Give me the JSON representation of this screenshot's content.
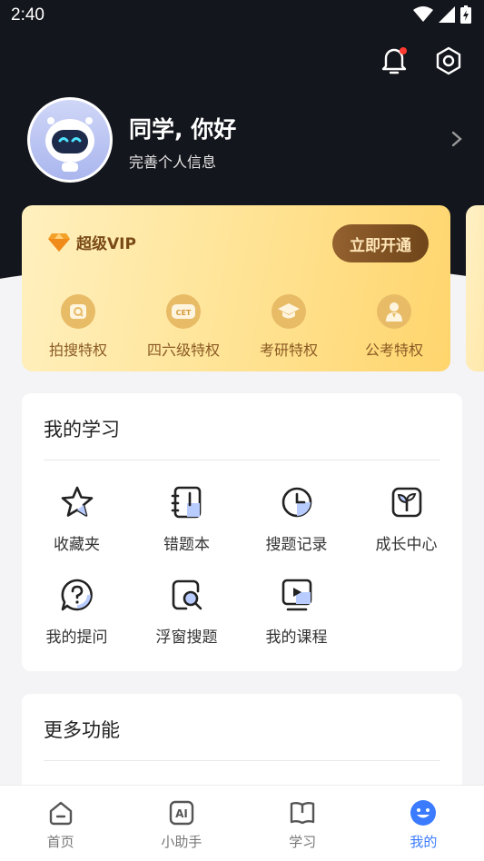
{
  "status_bar": {
    "time": "2:40"
  },
  "header": {
    "notifications_icon": "bell-icon",
    "settings_icon": "gear-icon"
  },
  "profile": {
    "greeting": "同学, 你好",
    "subtitle": "完善个人信息"
  },
  "vip": {
    "title": "超级VIP",
    "cta": "立即开通",
    "privileges": [
      {
        "label": "拍搜特权",
        "icon": "camera-icon"
      },
      {
        "label": "四六级特权",
        "icon": "cet-icon",
        "badge": "CET"
      },
      {
        "label": "考研特权",
        "icon": "graduation-cap-icon"
      },
      {
        "label": "公考特权",
        "icon": "civil-servant-icon"
      }
    ]
  },
  "study": {
    "title": "我的学习",
    "items": [
      {
        "label": "收藏夹",
        "icon": "star-icon"
      },
      {
        "label": "错题本",
        "icon": "notebook-icon"
      },
      {
        "label": "搜题记录",
        "icon": "clock-icon"
      },
      {
        "label": "成长中心",
        "icon": "sprout-icon"
      },
      {
        "label": "我的提问",
        "icon": "question-icon"
      },
      {
        "label": "浮窗搜题",
        "icon": "floating-search-icon"
      },
      {
        "label": "我的课程",
        "icon": "course-play-icon"
      }
    ]
  },
  "more": {
    "title": "更多功能"
  },
  "nav": {
    "items": [
      {
        "label": "首页",
        "icon": "home-icon"
      },
      {
        "label": "小助手",
        "icon": "ai-icon",
        "badge": "AI"
      },
      {
        "label": "学习",
        "icon": "book-icon"
      },
      {
        "label": "我的",
        "icon": "smiley-icon",
        "active": true
      }
    ]
  },
  "colors": {
    "dark_header": "#14161d",
    "accent": "#3a7bff",
    "vip_gold": "#ffd56d",
    "vip_button": "#7a4a16"
  }
}
